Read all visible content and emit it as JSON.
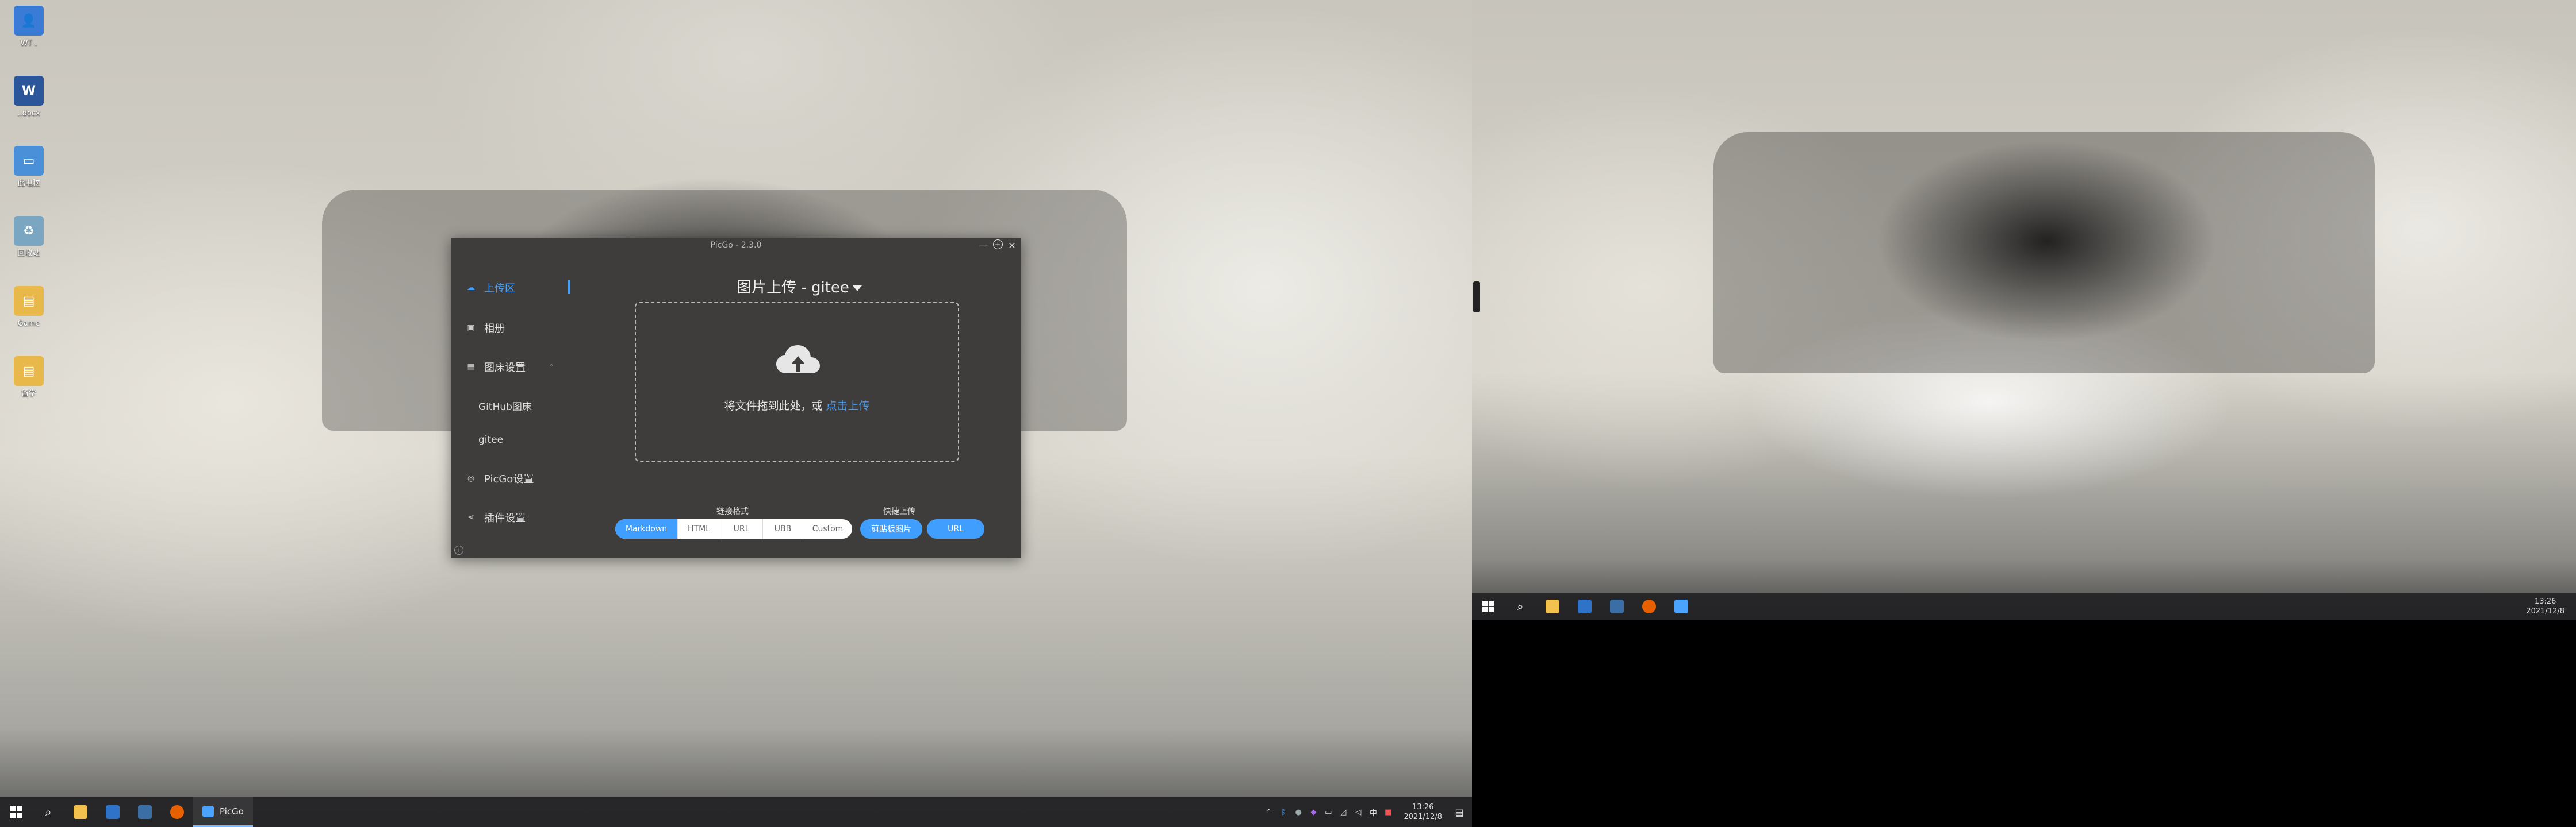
{
  "desktop": {
    "icons": [
      {
        "label": "WT .",
        "icon": "user-folder-icon",
        "color": "#3a7bd5"
      },
      {
        "label": "..docx",
        "icon": "word-document-icon",
        "color": "#2b579a"
      },
      {
        "label": "此电脑",
        "icon": "computer-icon",
        "color": "#4a90d9"
      },
      {
        "label": "回收站",
        "icon": "recycle-bin-icon",
        "color": "#7aa6c2"
      },
      {
        "label": "Game",
        "icon": "folder-icon",
        "color": "#e8b84a"
      },
      {
        "label": "留学",
        "icon": "folder-icon",
        "color": "#e8b84a"
      }
    ]
  },
  "picgo": {
    "window_title": "PicGo - 2.3.0",
    "controls": {
      "minimize": "—",
      "maximize": "+",
      "close": "✕"
    },
    "sidebar": {
      "upload": "上传区",
      "album": "相册",
      "pic_bed_settings": "图床设置",
      "github": "GitHub图床",
      "gitee": "gitee",
      "picgo_settings": "PicGo设置",
      "plugin_settings": "插件设置"
    },
    "title": "图片上传 - gitee",
    "dropzone": {
      "text": "将文件拖到此处，或 ",
      "link": "点击上传"
    },
    "link_format": {
      "label": "链接格式",
      "options": [
        "Markdown",
        "HTML",
        "URL",
        "UBB",
        "Custom"
      ],
      "selected": "Markdown"
    },
    "quick_upload": {
      "label": "快捷上传",
      "clipboard": "剪贴板图片",
      "url": "URL"
    },
    "accent_color": "#409eff"
  },
  "taskbar_left": {
    "apps": [
      {
        "icon": "start-icon"
      },
      {
        "icon": "search-icon"
      },
      {
        "icon": "file-explorer-icon",
        "color": "#f2c14e"
      },
      {
        "icon": "outlook-icon",
        "color": "#2e73c8"
      },
      {
        "icon": "app-icon",
        "color": "#3a6ea5"
      },
      {
        "icon": "firefox-icon",
        "color": "#e66000"
      }
    ],
    "active_app": "PicGo",
    "clock_time": "13:26",
    "clock_date": "2021/12/8"
  },
  "taskbar_right": {
    "clock_time": "13:26",
    "clock_date": "2021/12/8"
  }
}
